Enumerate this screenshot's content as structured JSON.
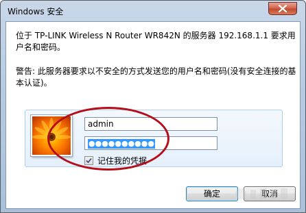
{
  "window": {
    "title": "Windows 安全"
  },
  "dialog": {
    "message": "位于 TP-LINK Wireless N Router WR842N 的服务器 192.168.1.1 要求用户名和密码。",
    "warning": "警告: 此服务器要求以不安全的方式发送您的用户名和密码(没有安全连接的基本认证)。"
  },
  "credentials": {
    "username_value": "admin",
    "password_masked": "●●●●●●●●●●",
    "remember_label": "记住我的凭据",
    "remember_checked": true
  },
  "buttons": {
    "ok_label": "确定",
    "cancel_label": "取消"
  },
  "colors": {
    "highlight_circle": "#b50e1a",
    "selection": "#3399ff"
  }
}
